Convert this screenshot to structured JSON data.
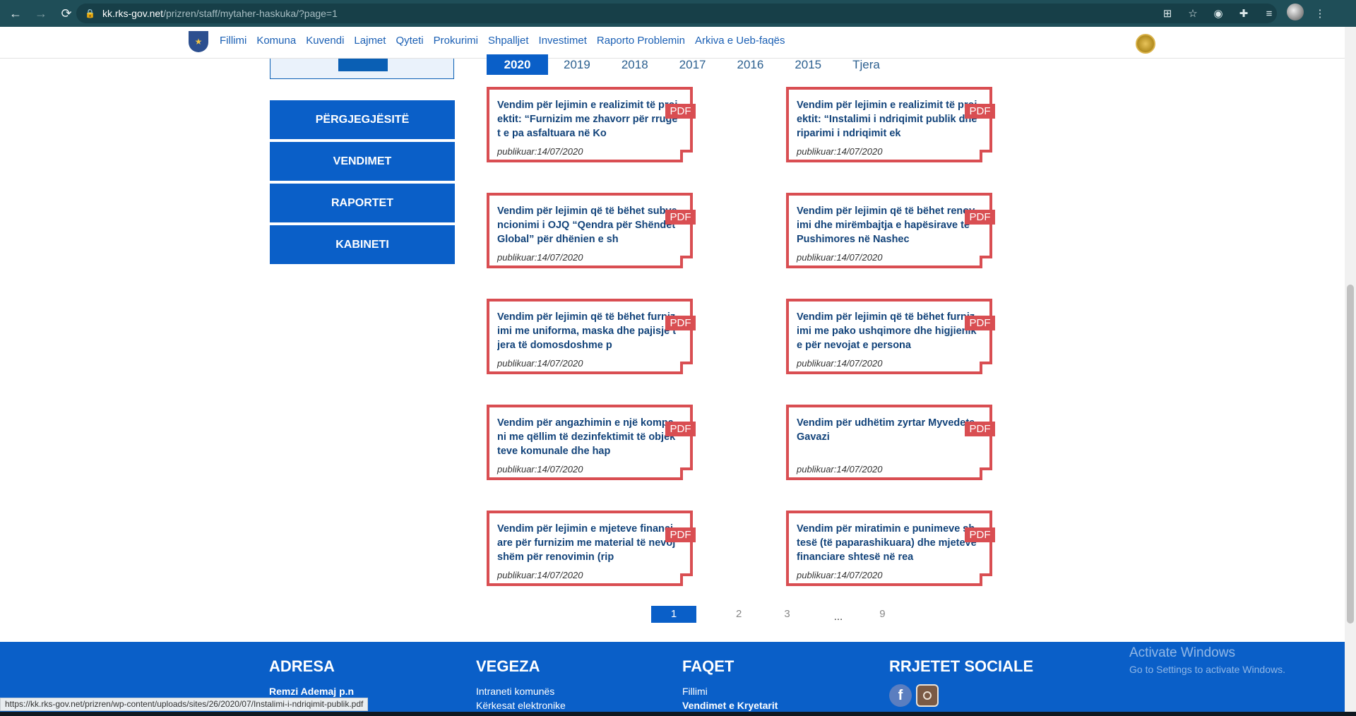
{
  "browser": {
    "url_host": "kk.rks-gov.net",
    "url_path": "/prizren/staff/mytaher-haskuka/?page=1",
    "status_url": "https://kk.rks-gov.net/prizren/wp-content/uploads/sites/26/2020/07/Instalimi-i-ndriqimit-publik.pdf"
  },
  "nav": [
    "Fillimi",
    "Komuna",
    "Kuvendi",
    "Lajmet",
    "Qyteti",
    "Prokurimi",
    "Shpalljet",
    "Investimet",
    "Raporto Problemin",
    "Arkiva e Ueb-faqës"
  ],
  "sidebar": [
    "PËRGJEGJËSITË",
    "VENDIMET",
    "RAPORTET",
    "KABINETI"
  ],
  "years": [
    "2020",
    "2019",
    "2018",
    "2017",
    "2016",
    "2015",
    "Tjera"
  ],
  "pdf_label": "PDF",
  "documents": [
    {
      "title": "Vendim për lejimin e realizimit të projektit: “Furnizim me zhavorr për rrugët e pa asfaltuara në Ko",
      "date": "publikuar:14/07/2020"
    },
    {
      "title": "Vendim për lejimin e realizimit të projektit: “Instalimi i ndriqimit publik dhe riparimi i ndriqimit ek",
      "date": "publikuar:14/07/2020"
    },
    {
      "title": "Vendim për lejimin që të bëhet subvencionimi i OJQ “Qendra për Shëndet Global” për dhënien e sh",
      "date": "publikuar:14/07/2020"
    },
    {
      "title": "Vendim për lejimin që të bëhet renovimi dhe mirëmbajtja e hapësirave të Pushimores në Nashec",
      "date": "publikuar:14/07/2020"
    },
    {
      "title": "Vendim për lejimin që të bëhet furnizimi me uniforma, maska dhe pajisje tjera të domosdoshme p",
      "date": "publikuar:14/07/2020"
    },
    {
      "title": "Vendim për lejimin që të bëhet furnizimi me pako ushqimore dhe higjienike për nevojat e persona",
      "date": "publikuar:14/07/2020"
    },
    {
      "title": "Vendim për angazhimin e një kompani me qëllim të dezinfektimit të objekteve komunale dhe hap",
      "date": "publikuar:14/07/2020"
    },
    {
      "title": "Vendim për udhëtim zyrtar Myvedete Gavazi",
      "date": "publikuar:14/07/2020"
    },
    {
      "title": "Vendim për lejimin e mjeteve financiare për furnizim me material të nevojshëm për renovimin (rip",
      "date": "publikuar:14/07/2020"
    },
    {
      "title": "Vendim për miratimin e punimeve shtesë (të paparashikuara) dhe mjeteve financiare shtesë në rea",
      "date": "publikuar:14/07/2020"
    }
  ],
  "pagination": [
    "1",
    "2",
    "3",
    "...",
    "9"
  ],
  "footer": {
    "adresa": {
      "heading": "ADRESA",
      "line1": "Remzi Ademaj p.n"
    },
    "vegeza": {
      "heading": "VEGEZA",
      "links": [
        "Intraneti komunës",
        "Kërkesat elektronike"
      ]
    },
    "faqet": {
      "heading": "FAQET",
      "links": [
        "Fillimi",
        "Vendimet e Kryetarit"
      ]
    },
    "rrjetet": {
      "heading": "RRJETET SOCIALE"
    }
  },
  "watermark": {
    "line1": "Activate Windows",
    "line2": "Go to Settings to activate Windows."
  },
  "colors": {
    "brand_blue": "#0a5fc8",
    "pdf_red": "#d94e52",
    "title_navy": "#12437a"
  }
}
